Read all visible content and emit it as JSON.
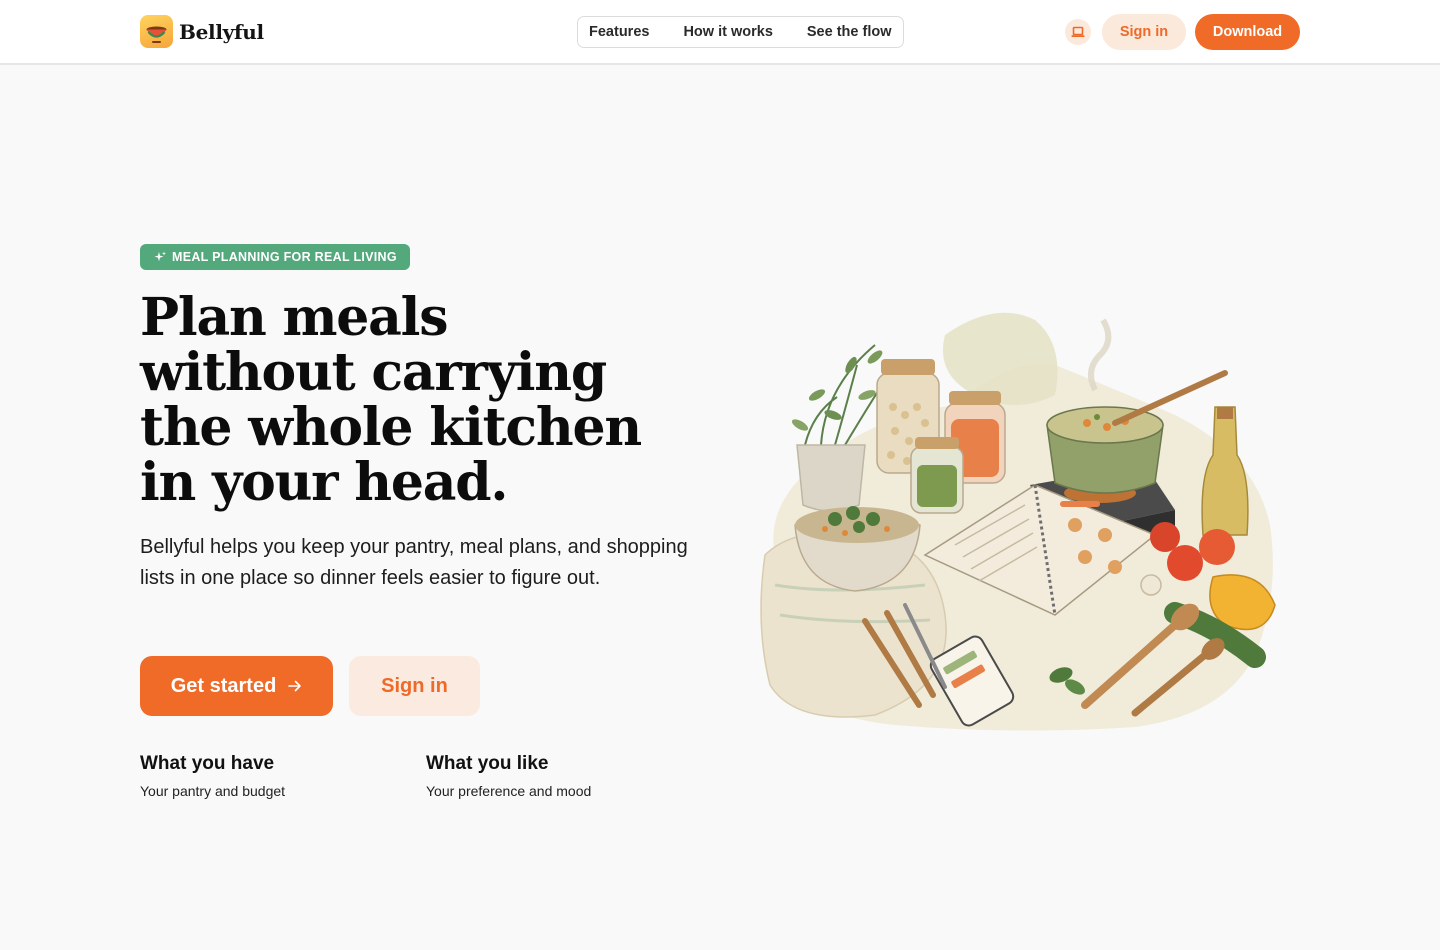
{
  "header": {
    "brand_name": "Bellyful",
    "nav": [
      "Features",
      "How it works",
      "See the flow"
    ],
    "signin_label": "Sign in",
    "download_label": "Download"
  },
  "hero": {
    "badge": "MEAL PLANNING FOR REAL LIVING",
    "headline_lines": [
      "Plan meals",
      "without carrying",
      "the whole kitchen",
      "in your head."
    ],
    "subtitle": "Bellyful helps you keep your pantry, meal plans, and shopping lists in one place so dinner feels easier to figure out.",
    "cta_primary": "Get started",
    "cta_secondary": "Sign in",
    "features": [
      {
        "title": "What you have",
        "subtitle": "Your pantry and budget"
      },
      {
        "title": "What you like",
        "subtitle": "Your preference and mood"
      }
    ]
  },
  "colors": {
    "accent": "#f06b27",
    "accent_soft": "#fbe9dc",
    "badge_green": "#53a87c",
    "background": "#f8f9f8"
  },
  "icons": {
    "logo": "soup-bowl-logo-icon",
    "device": "laptop-icon",
    "badge": "sparkle-icon",
    "cta": "arrow-right-icon"
  }
}
